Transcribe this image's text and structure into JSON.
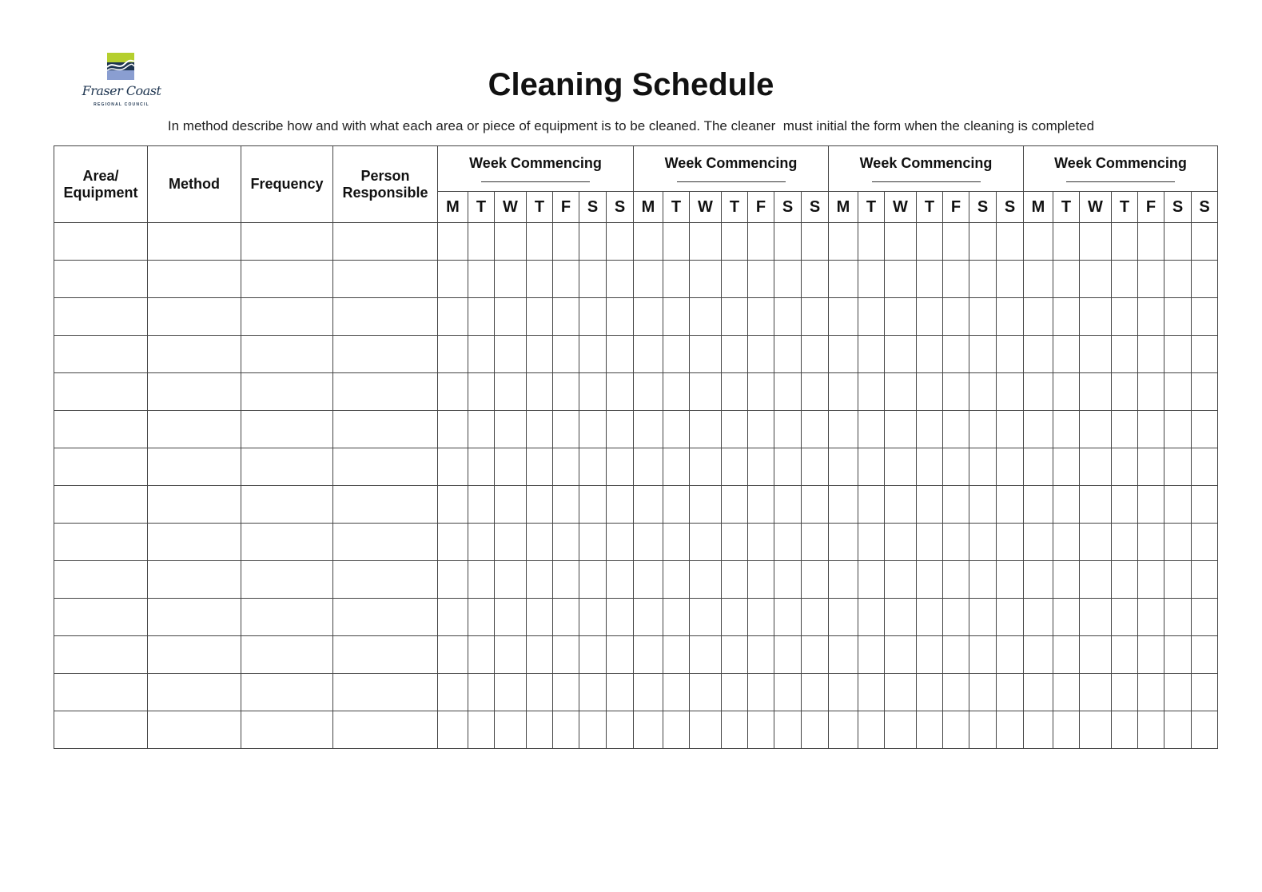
{
  "logo": {
    "name": "Fraser Coast",
    "subname": "REGIONAL COUNCIL",
    "colors": {
      "green": "#b5cf2e",
      "navy": "#1e3550",
      "blue": "#8a9ed1"
    }
  },
  "document": {
    "title": "Cleaning Schedule",
    "instructions": "In method describe how and with what each area or piece of equipment is to be cleaned. The cleaner  must initial the form when the cleaning is completed"
  },
  "table": {
    "columns": {
      "area": "Area/\nEquipment",
      "method": "Method",
      "frequency": "Frequency",
      "person": "Person\nResponsible"
    },
    "weeks": [
      {
        "label": "Week Commencing",
        "date": ""
      },
      {
        "label": "Week Commencing",
        "date": ""
      },
      {
        "label": "Week Commencing",
        "date": ""
      },
      {
        "label": "Week Commencing",
        "date": ""
      }
    ],
    "days": [
      "M",
      "T",
      "W",
      "T",
      "F",
      "S",
      "S"
    ],
    "row_count": 14,
    "rows": []
  }
}
